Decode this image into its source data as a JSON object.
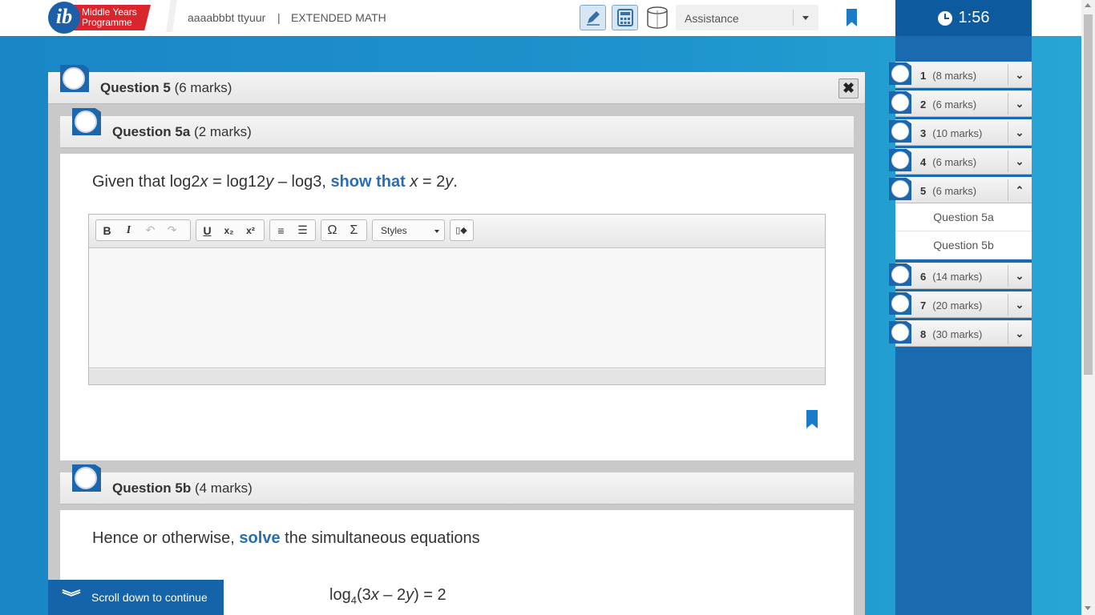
{
  "header": {
    "logo_line1": "Middle Years",
    "logo_line2": "Programme",
    "logo_letter": "ib",
    "user": "aaaabbbt ttyuur",
    "separator": "|",
    "subject": "EXTENDED MATH",
    "assistance_label": "Assistance",
    "timer": "1:56",
    "tools": [
      "pencil-icon",
      "calculator-icon",
      "cylinder-icon"
    ]
  },
  "question": {
    "number_label": "Question 5",
    "marks": "(6 marks)",
    "close_glyph": "✖"
  },
  "part_a": {
    "label": "Question 5a",
    "marks": "(2 marks)",
    "prompt_pre": "Given that log2",
    "prompt_x1": "x",
    "prompt_mid1": " = log12",
    "prompt_y1": "y",
    "prompt_mid2": " – log3,  ",
    "prompt_kw": "show that",
    "prompt_x2": "x",
    "prompt_mid3": " = 2",
    "prompt_y2": "y",
    "prompt_end": ".",
    "editor": {
      "bold": "B",
      "italic": "I",
      "undo": "↶",
      "redo": "↷",
      "underline": "U",
      "subscript": "x₂",
      "superscript": "x²",
      "ordered_list": "≡",
      "bullet_list": "☰",
      "omega": "Ω",
      "sigma": "Σ",
      "styles": "Styles",
      "source": "▯◆"
    }
  },
  "part_b": {
    "label": "Question 5b",
    "marks": "(4 marks)",
    "prompt_pre": "Hence or otherwise, ",
    "prompt_kw": "solve",
    "prompt_post": " the simultaneous equations",
    "eq_log": "log",
    "eq_base": "4",
    "eq_open": "(3",
    "eq_x": "x",
    "eq_mid": " – 2",
    "eq_y": "y",
    "eq_end": ") = 2"
  },
  "scroll_label": "Scroll down to continue",
  "scroll_glyph": "︾",
  "nav": {
    "items": [
      {
        "num": "1",
        "marks": "(8 marks)",
        "toggle": "⌄"
      },
      {
        "num": "2",
        "marks": "(6 marks)",
        "toggle": "⌄"
      },
      {
        "num": "3",
        "marks": "(10 marks)",
        "toggle": "⌄"
      },
      {
        "num": "4",
        "marks": "(6 marks)",
        "toggle": "⌄"
      },
      {
        "num": "5",
        "marks": "(6 marks)",
        "toggle": "⌃"
      },
      {
        "num": "6",
        "marks": "(14 marks)",
        "toggle": "⌄"
      },
      {
        "num": "7",
        "marks": "(20 marks)",
        "toggle": "⌄"
      },
      {
        "num": "8",
        "marks": "(30 marks)",
        "toggle": "⌄"
      }
    ],
    "sub_items": [
      "Question 5a",
      "Question 5b"
    ]
  },
  "colors": {
    "brand_blue": "#1b66ad",
    "keyword_blue": "#2a6db3",
    "logo_red": "#d9262d",
    "timer_bg": "#0e5a9e"
  }
}
